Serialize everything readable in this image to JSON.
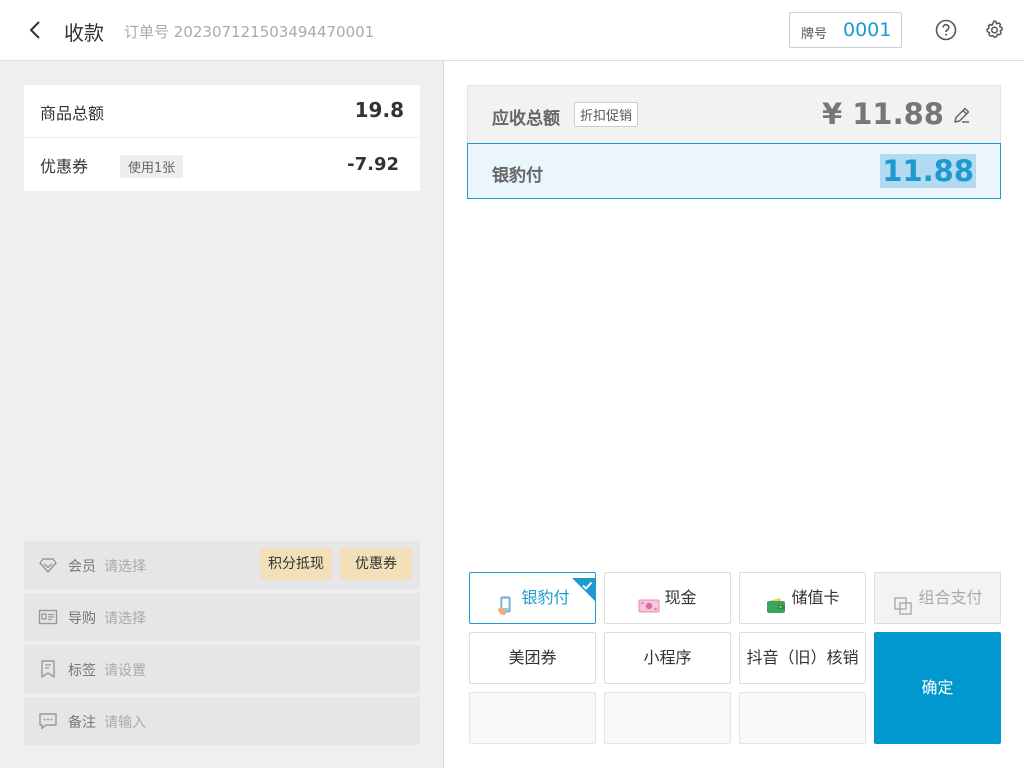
{
  "header": {
    "title": "收款",
    "order_label": "订单号",
    "order_number": "20230712150349447000​1",
    "plate_label": "牌号",
    "plate_value": "0001"
  },
  "summary": {
    "goods_total_label": "商品总额",
    "goods_total_value": "19.8",
    "coupon_label": "优惠券",
    "coupon_tag": "使用1张",
    "coupon_value": "-7.92"
  },
  "info_rows": [
    {
      "label": "会员",
      "placeholder": "请选择"
    },
    {
      "label": "导购",
      "placeholder": "请选择"
    },
    {
      "label": "标签",
      "placeholder": "请设置"
    },
    {
      "label": "备注",
      "placeholder": "请输入"
    }
  ],
  "member_buttons": {
    "points": "积分抵现",
    "coupon": "优惠券"
  },
  "due": {
    "label": "应收总额",
    "discount_button": "折扣促销",
    "amount": "¥ 11.88"
  },
  "payment": {
    "label": "银豹付",
    "amount": "11.88"
  },
  "pay_methods": {
    "yinbao": "银豹付",
    "cash": "现金",
    "stored_card": "储值卡",
    "combo": "组合支付",
    "meituan": "美团券",
    "mini_program": "小程序",
    "douyin": "抖音（旧）核销"
  },
  "confirm_label": "确定",
  "colors": {
    "accent": "#1d9bd0",
    "confirm": "#0098cf",
    "member_button": "#f3e0b8",
    "left_bg": "#eeeff1"
  }
}
